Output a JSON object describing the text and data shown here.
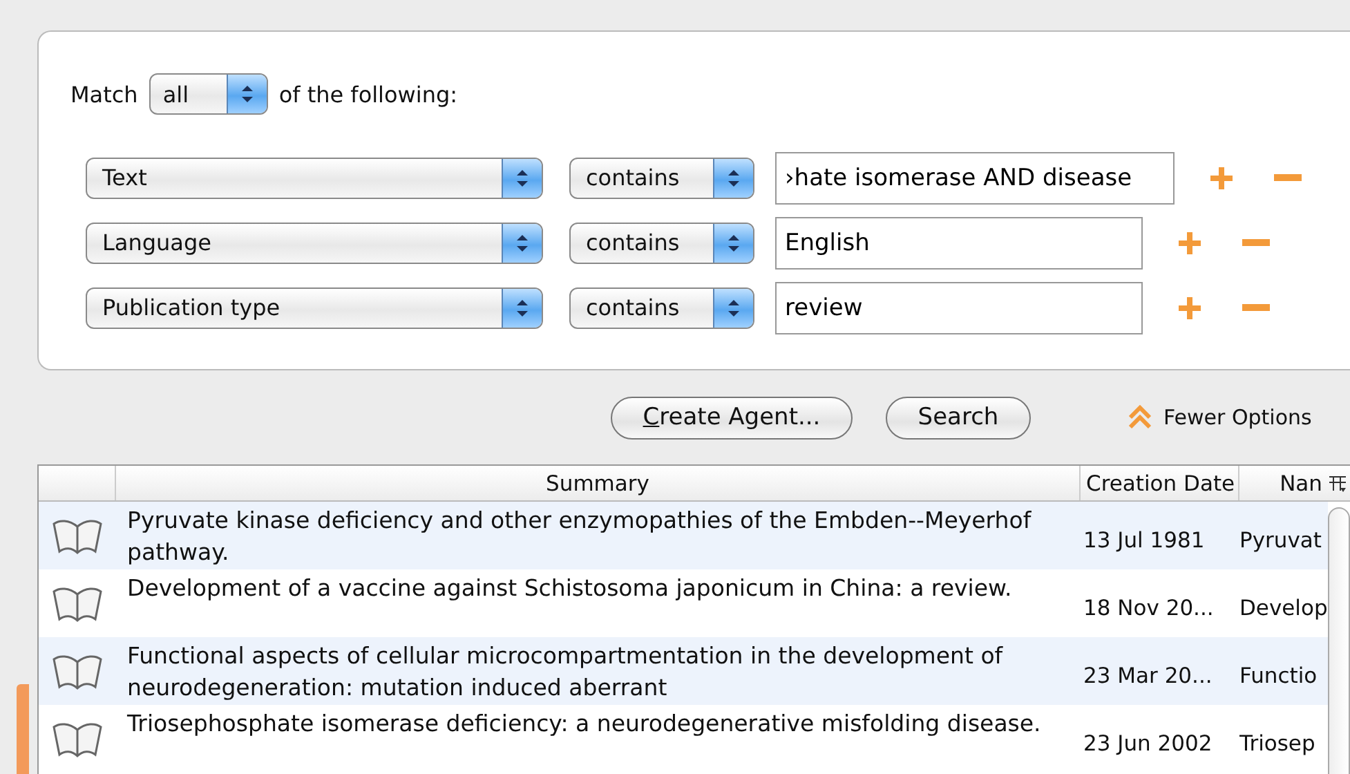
{
  "match": {
    "label_before": "Match",
    "value": "all",
    "label_after": "of the following:"
  },
  "criteria": [
    {
      "field": "Text",
      "operator": "contains",
      "value": "›hate isomerase AND disease"
    },
    {
      "field": "Language",
      "operator": "contains",
      "value": "English"
    },
    {
      "field": "Publication type",
      "operator": "contains",
      "value": "review"
    }
  ],
  "buttons": [
    {
      "mnemonic": "C",
      "label": "reate Agent..."
    },
    {
      "label": "Search"
    }
  ],
  "fewer_options": "Fewer Options",
  "table": {
    "columns": [
      "Summary",
      "Creation Date",
      "Nan"
    ],
    "rows": [
      {
        "summary": "Pyruvate kinase deficiency and other enzymopathies of the Embden--Meyerhof pathway.",
        "date": "13 Jul 1981",
        "name": "Pyruvat"
      },
      {
        "summary": "Development of a vaccine against Schistosoma japonicum in China: a review.",
        "date": "18 Nov 20...",
        "name": "Develop"
      },
      {
        "summary": "Functional aspects of cellular microcompartmentation in the development of neurodegeneration: mutation induced aberrant",
        "date": "23 Mar 20...",
        "name": "Functio"
      },
      {
        "summary": "Triosephosphate isomerase deficiency: a neurodegenerative misfolding disease.",
        "date": "23 Jun 2002",
        "name": "Triosep"
      }
    ]
  }
}
